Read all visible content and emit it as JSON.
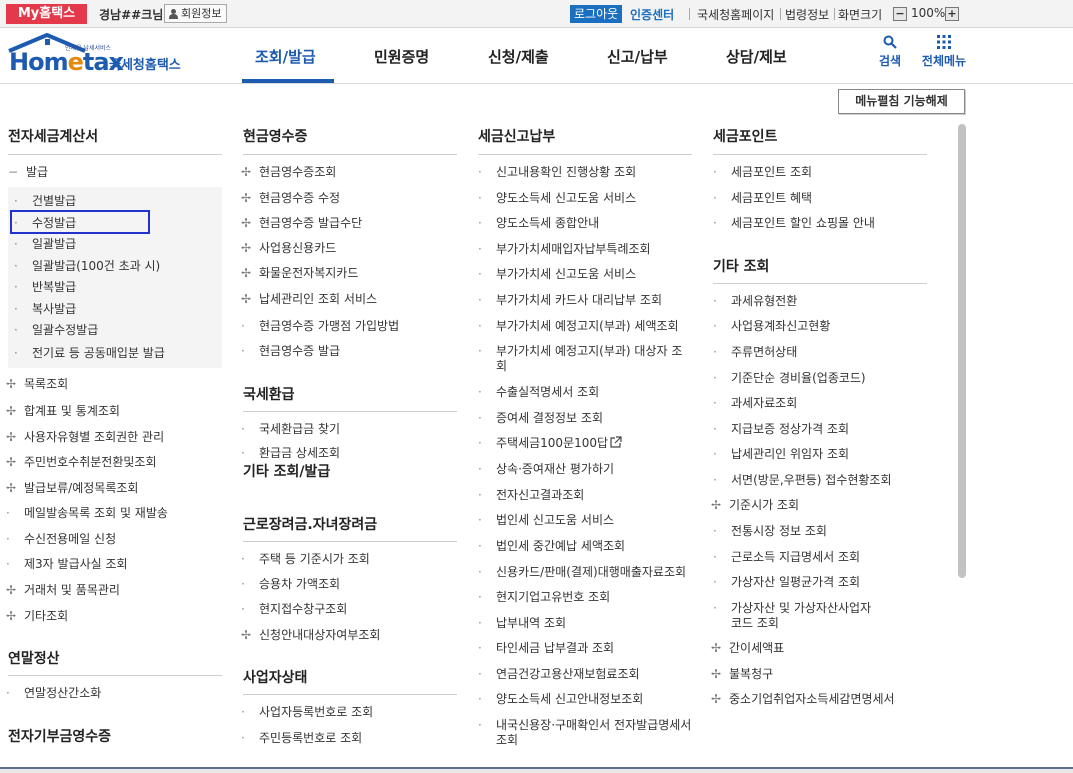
{
  "topbar": {
    "my_hometax": "My홈택스",
    "user_name": "경남##크님",
    "member_info": "회원정보",
    "logout": "로그아웃",
    "cert_center": "인증센터",
    "nts_page": "국세청홈페이지",
    "law_info": "법령정보",
    "screen_size": "화면크기",
    "zoom_minus": "−",
    "zoom_value": "100%",
    "zoom_plus": "+"
  },
  "header": {
    "logo_slogan": "언제온 납세서비스",
    "logo_home": "Hom",
    "logo_e": "e",
    "logo_tax": "tax",
    "logo_nts": "국세청홈택스",
    "nav": [
      "조회/발급",
      "민원증명",
      "신청/제출",
      "신고/납부",
      "상담/제보"
    ],
    "search": "검색",
    "all_menu": "전체메뉴"
  },
  "fold_button": "메뉴펼침 기능해제",
  "columns": {
    "c1": {
      "title": "전자세금계산서",
      "group": "발급",
      "sub": [
        "건별발급",
        "수정발급",
        "일괄발급",
        "일괄발급(100건 초과 시)",
        "반복발급",
        "복사발급",
        "일괄수정발급",
        "전기료 등 공동매입분 발급"
      ],
      "items": [
        "목록조회",
        "합계표 및 통계조회",
        "사용자유형별 조회권한 관리",
        "주민번호수취분전환및조회",
        "발급보류/예정목록조회",
        "메일발송목록 조회 및 재발송",
        "수신전용메일 신청",
        "제3자 발급사실 조회",
        "거래처 및 품목관리",
        "기타조회"
      ],
      "title2": "연말정산",
      "items2": [
        "연말정산간소화"
      ],
      "title3": "전자기부금영수증"
    },
    "c2": {
      "title": "현금영수증",
      "items": [
        "현금영수증조회",
        "현금영수증 수정",
        "현금영수증 발급수단",
        "사업용신용카드",
        "화물운전자복지카드",
        "납세관리인 조회 서비스",
        "현금영수증 가맹점 가입방법",
        "현금영수증 발급"
      ],
      "title2": "국세환급",
      "items2": [
        "국세환급금 찾기",
        "환급금 상세조회"
      ],
      "title3": "기타 조회/발급",
      "title4": "근로장려금.자녀장려금",
      "items4": [
        "주택 등 기준시가 조회",
        "승용차 가액조회",
        "현지접수창구조회",
        "신청안내대상자여부조회"
      ],
      "title5": "사업자상태",
      "items5": [
        "사업자등록번호로 조회",
        "주민등록번호로 조회"
      ]
    },
    "c3": {
      "title": "세금신고납부",
      "items": [
        "신고내용확인 진행상황 조회",
        "양도소득세 신고도움 서비스",
        "양도소득세 종합안내",
        "부가가치세매입자납부특례조회",
        "부가가치세 신고도움 서비스",
        "부가가치세 카드사 대리납부 조회",
        "부가가치세 예정고지(부과) 세액조회",
        "부가가치세 예정고지(부과) 대상자 조회",
        "수출실적명세서 조회",
        "증여세 결정정보 조회",
        "주택세금100문100답",
        "상속·증여재산 평가하기",
        "전자신고결과조회",
        "법인세 신고도움 서비스",
        "법인세 중간예납 세액조회",
        "신용카드/판매(결제)대행매출자료조회",
        "현지기업고유번호 조회",
        "납부내역 조회",
        "타인세금 납부결과 조회",
        "연금건강고용산재보험료조회",
        "양도소득세 신고안내정보조회",
        "내국신용장·구매확인서 전자발급명세서 조회"
      ]
    },
    "c4": {
      "title": "세금포인트",
      "items": [
        "세금포인트 조회",
        "세금포인트 혜택",
        "세금포인트 할인 쇼핑몰 안내"
      ],
      "title2": "기타 조회",
      "items2": [
        "과세유형전환",
        "사업용계좌신고현황",
        "주류면허상태",
        "기준단순 경비율(업종코드)",
        "과세자료조회",
        "지급보증 정상가격 조회",
        "납세관리인 위임자 조회",
        "서면(방문,우편등) 접수현황조회",
        "기준시가 조회",
        "전통시장 정보 조회",
        "근로소득 지급명세서 조회",
        "가상자산 일평균가격 조회",
        "가상자산 및 가상자산사업자 코드 조회",
        "간이세액표",
        "불복청구",
        "중소기업취업자소득세감면명세서"
      ]
    }
  }
}
